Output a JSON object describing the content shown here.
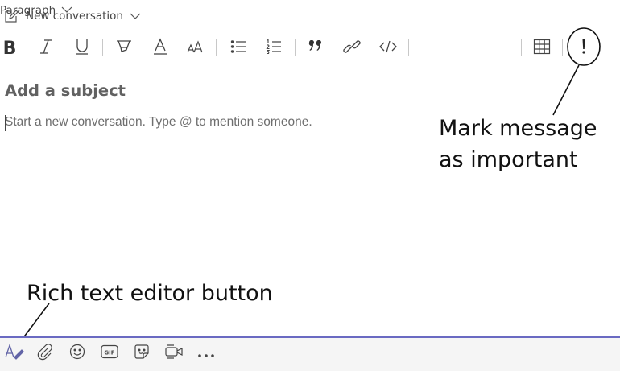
{
  "header": {
    "new_conversation_label": "New conversation"
  },
  "toolbar": {
    "bold_label": "B",
    "paragraph_label": "Paragraph"
  },
  "compose": {
    "subject_placeholder": "Add a subject",
    "body_placeholder": "Start a new conversation. Type @ to mention someone."
  },
  "annotations": {
    "important_line1": "Mark message",
    "important_line2": "as important",
    "rich_text": "Rich text editor button"
  },
  "icons": [
    "compose-edit-icon",
    "chevron-down-icon",
    "bold-icon",
    "italic-icon",
    "underline-icon",
    "highlight-icon",
    "font-color-icon",
    "font-size-icon",
    "bulleted-list-icon",
    "numbered-list-icon",
    "quote-icon",
    "link-icon",
    "code-icon",
    "table-icon",
    "important-icon",
    "format-icon",
    "attach-icon",
    "emoji-icon",
    "gif-icon",
    "sticker-icon",
    "meet-now-icon",
    "more-options-icon"
  ],
  "colors": {
    "accent": "#6a6ac2",
    "format_icon": "#6264a7"
  }
}
